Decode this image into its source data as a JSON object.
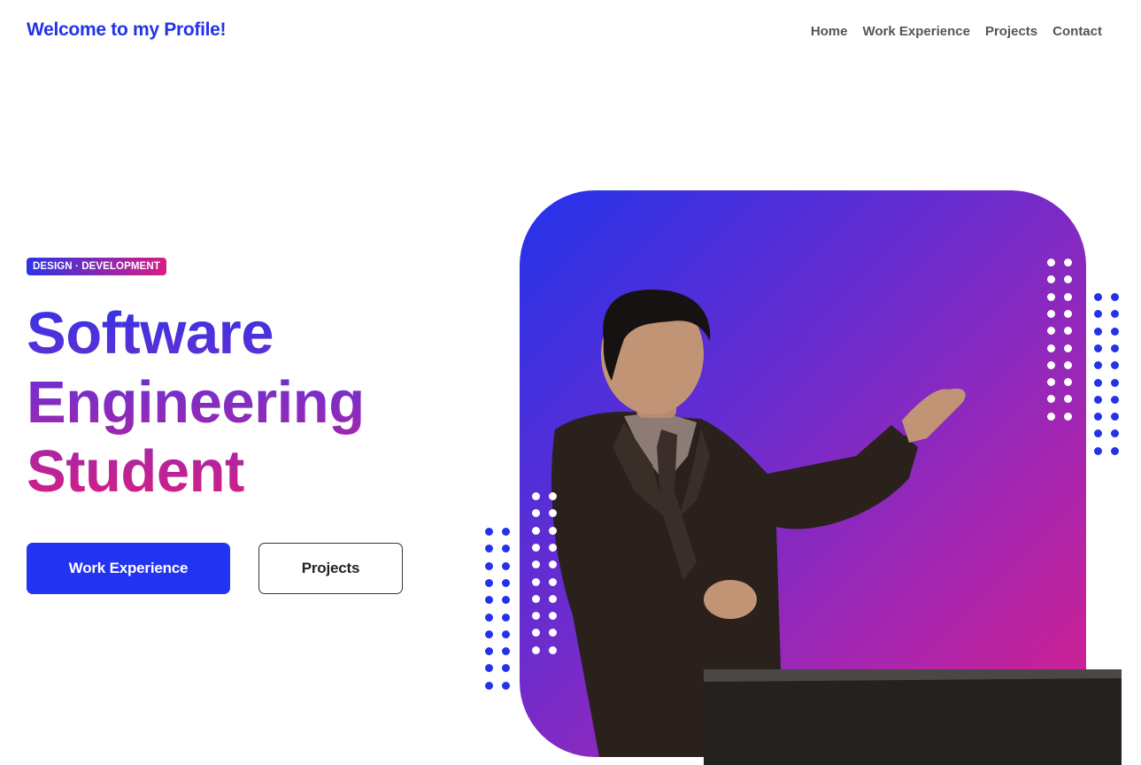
{
  "header": {
    "brand": "Welcome to my Profile!",
    "nav": [
      {
        "label": "Home"
      },
      {
        "label": "Work Experience"
      },
      {
        "label": "Projects"
      },
      {
        "label": "Contact"
      }
    ]
  },
  "hero": {
    "badge": "DESIGN · DEVELOPMENT",
    "headline_lines": [
      "Software",
      "Engineering",
      "Student"
    ],
    "primary_button": "Work Experience",
    "secondary_button": "Projects"
  },
  "colors": {
    "brand_blue": "#2233e8",
    "gradient_start": "#2333ea",
    "gradient_end": "#d81f8a",
    "dot_blue": "#2233e8",
    "dot_white": "#ffffff"
  }
}
